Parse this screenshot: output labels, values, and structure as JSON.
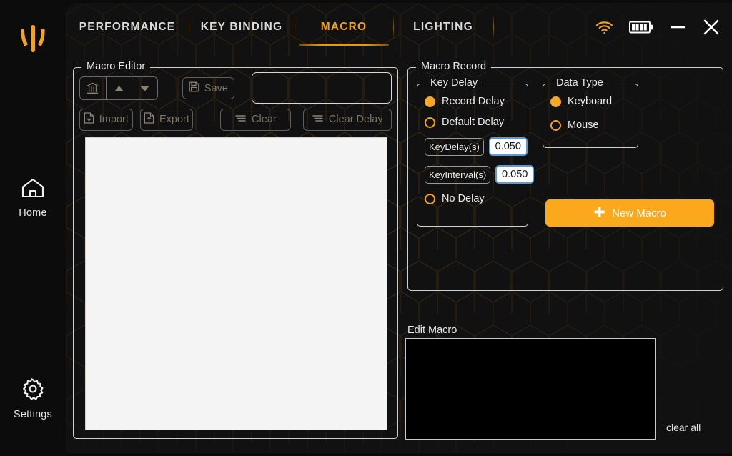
{
  "sidebar": {
    "logo_icon": "brand-logo-icon",
    "items": [
      {
        "id": "home",
        "label": "Home",
        "icon": "home-icon"
      },
      {
        "id": "settings",
        "label": "Settings",
        "icon": "gear-icon"
      }
    ]
  },
  "tabs": [
    {
      "id": "performance",
      "label": "PERFORMANCE",
      "active": false
    },
    {
      "id": "keybinding",
      "label": "KEY BINDING",
      "active": false
    },
    {
      "id": "macro",
      "label": "MACRO",
      "active": true
    },
    {
      "id": "lighting",
      "label": "LIGHTING",
      "active": false
    }
  ],
  "window_controls": [
    {
      "id": "wifi",
      "icon": "wifi-icon",
      "color": "#f5a214"
    },
    {
      "id": "battery",
      "icon": "battery-icon",
      "color": "#ffffff",
      "bars": 4
    },
    {
      "id": "minimize",
      "icon": "minimize-icon",
      "color": "#ffffff"
    },
    {
      "id": "close",
      "icon": "close-icon",
      "color": "#ffffff"
    }
  ],
  "macro_editor": {
    "legend": "Macro Editor",
    "delete_icon": "delete-icon",
    "move_up_icon": "triangle-up-icon",
    "move_down_icon": "triangle-down-icon",
    "save_label": "Save",
    "save_icon": "floppy-disk-icon",
    "name_value": "",
    "name_placeholder": "",
    "import_label": "Import",
    "import_icon": "file-download-icon",
    "export_label": "Export",
    "export_icon": "file-upload-icon",
    "clear_label": "Clear",
    "clear_icon": "list-lines-icon",
    "clear_delay_label": "Clear Delay",
    "clear_delay_icon": "list-lines-icon",
    "list_items": []
  },
  "macro_record": {
    "legend": "Macro Record",
    "key_delay": {
      "legend": "Key Delay",
      "options": [
        {
          "id": "record-delay",
          "label": "Record Delay",
          "selected": true
        },
        {
          "id": "default-delay",
          "label": "Default Delay",
          "selected": false
        },
        {
          "id": "no-delay",
          "label": "No Delay",
          "selected": false
        }
      ],
      "fields": [
        {
          "id": "keydelay",
          "label": "KeyDelay(s)",
          "value": "0.050"
        },
        {
          "id": "keyinterval",
          "label": "KeyInterval(s)",
          "value": "0.050"
        }
      ]
    },
    "data_type": {
      "legend": "Data Type",
      "options": [
        {
          "id": "keyboard",
          "label": "Keyboard",
          "selected": true
        },
        {
          "id": "mouse",
          "label": "Mouse",
          "selected": false
        }
      ]
    },
    "new_macro_label": "New Macro",
    "new_macro_icon": "plus-icon",
    "new_macro_color": "#fba81c"
  },
  "edit_macro": {
    "label": "Edit Macro",
    "content": "",
    "clear_all_label": "clear all"
  },
  "theme": {
    "accent": "#f5a214",
    "background": "#0b0b0b",
    "panel": "#111111",
    "text": "#e9e9ec"
  }
}
